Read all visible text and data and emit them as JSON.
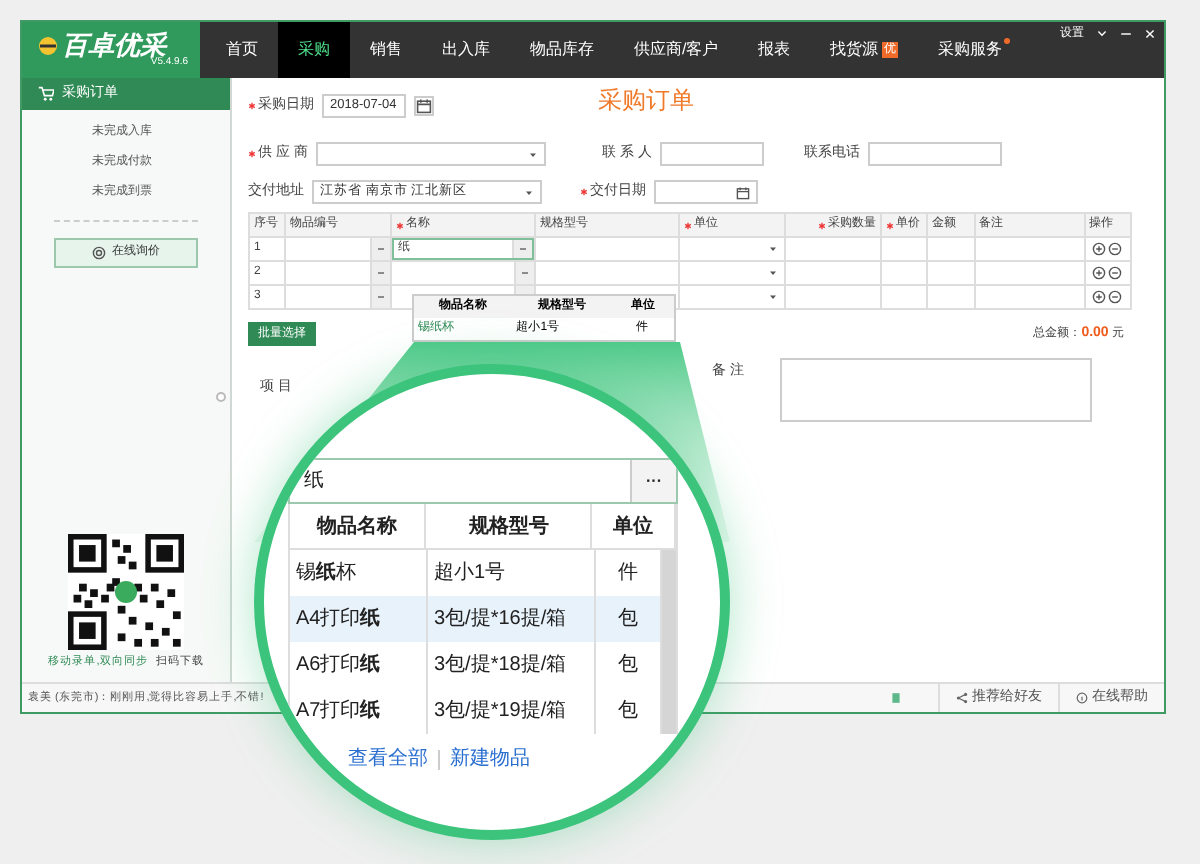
{
  "app": {
    "logo": "百卓优采",
    "version": "V5.4.9.6"
  },
  "nav": [
    {
      "label": "首页",
      "selected": false
    },
    {
      "label": "采购",
      "selected": true
    },
    {
      "label": "销售",
      "selected": false
    },
    {
      "label": "出入库",
      "selected": false
    },
    {
      "label": "物品库存",
      "selected": false
    },
    {
      "label": "供应商/客户",
      "selected": false
    },
    {
      "label": "报表",
      "selected": false
    },
    {
      "label": "找货源",
      "selected": false,
      "badge": "优"
    },
    {
      "label": "采购服务",
      "selected": false,
      "dot": true
    }
  ],
  "window_controls": {
    "settings": "设置"
  },
  "sidebar": {
    "header": "采购订单",
    "items": [
      "未完成入库",
      "未完成付款",
      "未完成到票"
    ],
    "inquiry_button": "在线询价",
    "qr_caption": "移动录单,双向同步",
    "qr_link": "扫码下载"
  },
  "form": {
    "title": "采购订单",
    "purchase_date": {
      "label": "采购日期",
      "required": true,
      "value": "2018-07-04"
    },
    "supplier": {
      "label": "供 应 商",
      "required": true
    },
    "contact": {
      "label": "联 系 人",
      "required": false
    },
    "phone": {
      "label": "联系电话",
      "required": false
    },
    "address": {
      "label": "交付地址",
      "required": false,
      "value": "江苏省 南京市 江北新区"
    },
    "delivery_date": {
      "label": "交付日期",
      "required": true
    },
    "project": {
      "label": "项 目",
      "required": false
    },
    "remark": {
      "label": "备 注",
      "required": false
    }
  },
  "table": {
    "columns": [
      {
        "label": "序号",
        "required": false
      },
      {
        "label": "物品编号",
        "required": false
      },
      {
        "label": "名称",
        "required": true
      },
      {
        "label": "规格型号",
        "required": false
      },
      {
        "label": "单位",
        "required": true
      },
      {
        "label": "采购数量",
        "required": true
      },
      {
        "label": "单价",
        "required": true
      },
      {
        "label": "金额",
        "required": false
      },
      {
        "label": "备注",
        "required": false
      },
      {
        "label": "操作",
        "required": false
      }
    ],
    "rows": [
      {
        "no": "1",
        "name": "纸"
      },
      {
        "no": "2",
        "name": ""
      },
      {
        "no": "3",
        "name": ""
      }
    ]
  },
  "batch_button": "批量选择",
  "total": {
    "label": "总金额：",
    "value": "0.00",
    "unit": "元"
  },
  "small_dropdown": {
    "columns": [
      "物品名称",
      "规格型号",
      "单位"
    ],
    "rows": [
      [
        "锡纸杯",
        "超小1号",
        "件"
      ]
    ]
  },
  "magnifier": {
    "search": "纸",
    "more": "···",
    "columns": [
      "物品名称",
      "规格型号",
      "单位"
    ],
    "rows": [
      {
        "cells": [
          "锡**纸**杯",
          "超小1号",
          "件"
        ],
        "selected": false
      },
      {
        "cells": [
          "A4打印**纸**",
          "3包/提*16提/箱",
          "包"
        ],
        "selected": true
      },
      {
        "cells": [
          "A6打印**纸**",
          "3包/提*18提/箱",
          "包"
        ],
        "selected": false
      },
      {
        "cells": [
          "A7打印**纸**",
          "3包/提*19提/箱",
          "包"
        ],
        "selected": false
      }
    ],
    "links": [
      "查看全部",
      "新建物品"
    ]
  },
  "status_bar": {
    "message": "袁美 (东莞市)：刚刚用,觉得比容易上手,不错!",
    "share": "推荐给好友",
    "help": "在线帮助"
  }
}
